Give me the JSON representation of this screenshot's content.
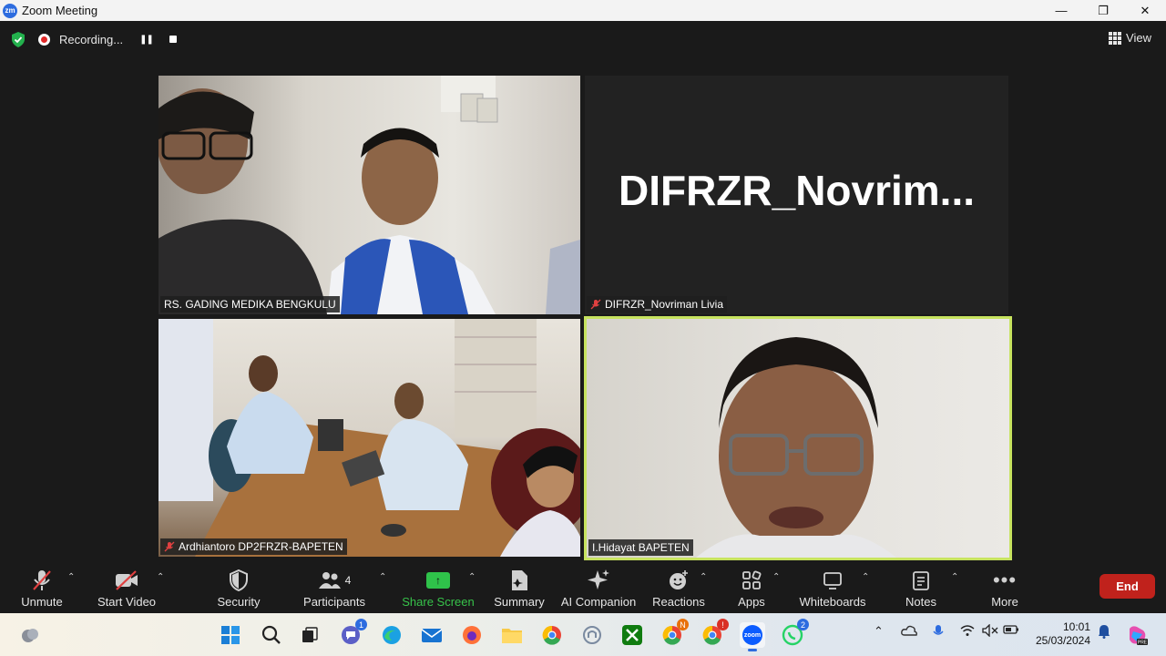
{
  "window": {
    "title": "Zoom Meeting",
    "app_icon": "zoom-logo",
    "logo_text": "zm"
  },
  "topbar": {
    "recording_label": "Recording...",
    "view_label": "View"
  },
  "participants": [
    {
      "name": "RS. GADING MEDIKA BENGKULU",
      "muted": false
    },
    {
      "name": "DIFRZR_Novriman Livia",
      "muted": true,
      "display_name": "DIFRZR_Novrim..."
    },
    {
      "name": "Ardhiantoro DP2FRZR-BAPETEN",
      "muted": true
    },
    {
      "name": "I.Hidayat BAPETEN",
      "muted": false,
      "active_speaker": true
    }
  ],
  "toolbar": {
    "items": [
      {
        "label": "Unmute",
        "icon": "mic-muted-icon"
      },
      {
        "label": "Start Video",
        "icon": "video-off-icon"
      },
      {
        "label": "Security",
        "icon": "shield-icon"
      },
      {
        "label": "Participants",
        "icon": "people-icon",
        "count": "4"
      },
      {
        "label": "Share Screen",
        "icon": "share-screen-icon"
      },
      {
        "label": "Summary",
        "icon": "summary-icon"
      },
      {
        "label": "AI Companion",
        "icon": "sparkle-icon"
      },
      {
        "label": "Reactions",
        "icon": "emoji-icon"
      },
      {
        "label": "Apps",
        "icon": "apps-icon"
      },
      {
        "label": "Whiteboards",
        "icon": "whiteboard-icon"
      },
      {
        "label": "Notes",
        "icon": "notes-icon"
      },
      {
        "label": "More",
        "icon": "more-icon"
      }
    ],
    "end_label": "End"
  },
  "taskbar": {
    "badges": {
      "teams": "1",
      "chrome_n": "N",
      "chrome_1": "!",
      "whatsapp": "2"
    },
    "zoom_text": "zoom",
    "time": "10:01",
    "date": "25/03/2024"
  },
  "colors": {
    "accent_green": "#37c24a",
    "end_red": "#c0221c",
    "speaker_border": "#c7e35f"
  }
}
